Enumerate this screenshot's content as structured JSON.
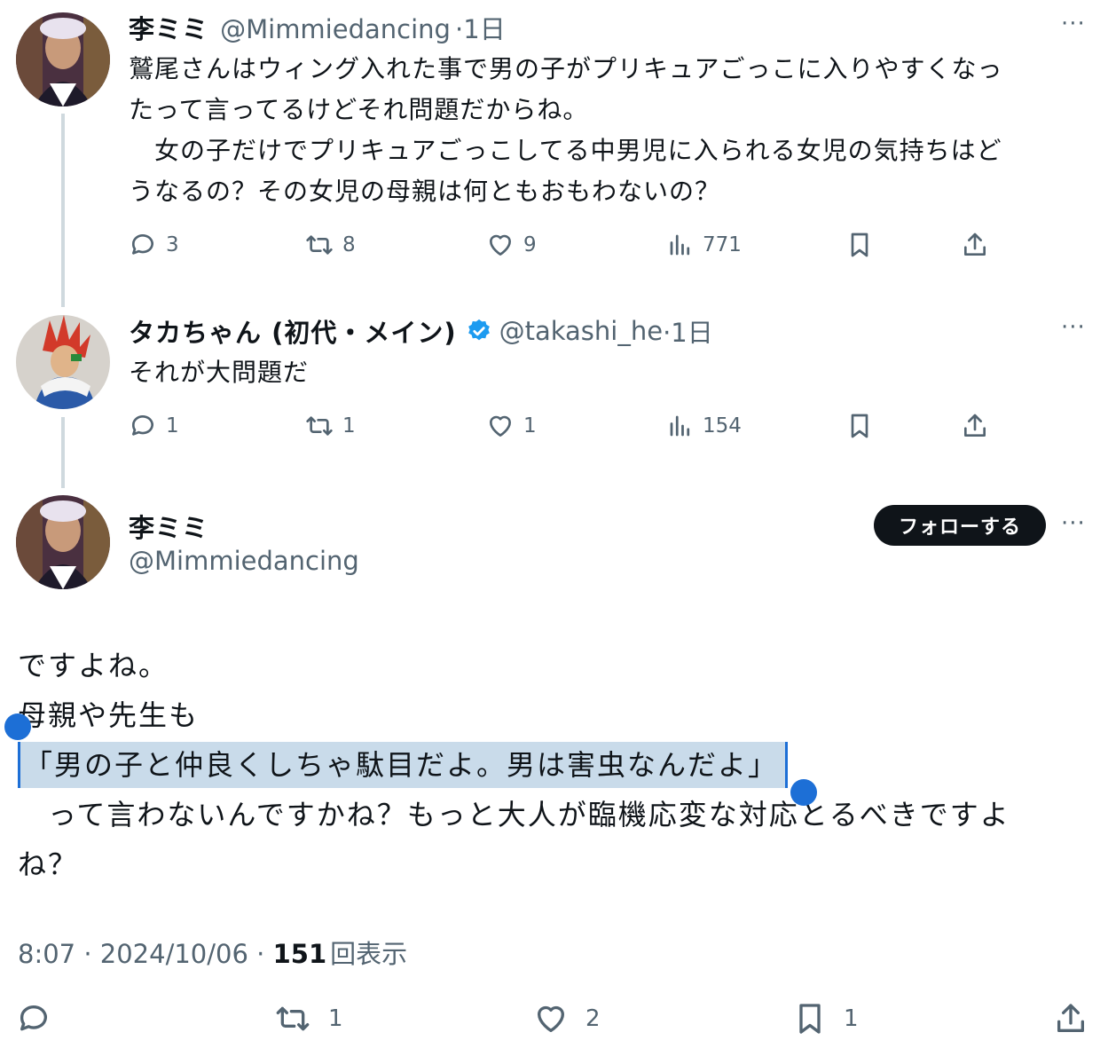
{
  "tweets": [
    {
      "author": "李ミミ",
      "handle": "@Mimmiedancing",
      "time": "·1日",
      "lines": [
        "鷲尾さんはウィング入れた事で男の子がプリキュアごっこに入りやすくなっ",
        "たって言ってるけどそれ問題だからね。",
        "　女の子だけでプリキュアごっこしてる中男児に入られる女児の気持ちはど",
        "うなるの？その女児の母親は何ともおもわないの？"
      ],
      "replies": "3",
      "retweets": "8",
      "likes": "9",
      "views": "771"
    },
    {
      "author": "タカちゃん (初代・メイン)",
      "handle": "@takashi_he",
      "time": "·1日",
      "lines": [
        "それが大問題だ"
      ],
      "replies": "1",
      "retweets": "1",
      "likes": "1",
      "views": "154"
    }
  ],
  "main": {
    "author": "李ミミ",
    "handle": "@Mimmiedancing",
    "follow_label": "フォローする",
    "line1": "ですよね。",
    "line2": "母親や先生も",
    "selected": "「男の子と仲良くしちゃ駄目だよ。男は害虫なんだよ」",
    "line4": "　って言わないんですかね？もっと大人が臨機応変な対応とるべきですよ",
    "line5": "ね？",
    "time": "8:07 · 2024/10/06 · ",
    "views": "151",
    "views_label": "回表示",
    "retweets": "1",
    "likes": "2",
    "bookmarks": "1"
  },
  "more_glyph": "···",
  "colors": {
    "accent": "#1d9bf0",
    "selection": "#c9dbea",
    "follow_bg": "#0f1419"
  },
  "icons": [
    "reply-icon",
    "retweet-icon",
    "like-icon",
    "views-icon",
    "bookmark-icon",
    "share-icon",
    "verified-icon",
    "more-icon"
  ]
}
